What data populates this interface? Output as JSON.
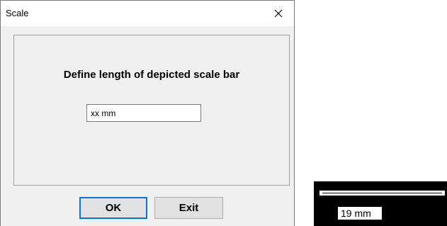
{
  "window": {
    "title": "Scale",
    "close_icon": "close-icon"
  },
  "dialog": {
    "prompt": "Define length of depicted scale bar",
    "length_input": {
      "value": "xx mm",
      "placeholder": ""
    },
    "ok_label": "OK",
    "exit_label": "Exit"
  },
  "preview": {
    "scale_label": "19 mm"
  }
}
